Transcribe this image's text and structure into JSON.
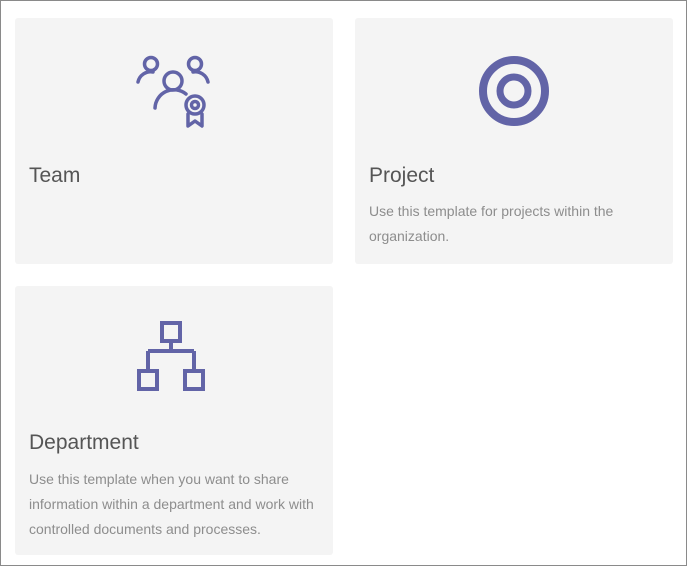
{
  "colors": {
    "accent": "#6264a7",
    "card_bg": "#f4f4f4",
    "title": "#555555",
    "description": "#8d8d8d"
  },
  "templates": [
    {
      "title": "Team",
      "description": "",
      "icon": "team-award-icon"
    },
    {
      "title": "Project",
      "description": "Use this template for projects within the organization.",
      "icon": "target-icon"
    },
    {
      "title": "Department",
      "description": "Use this template when you want to share information within a department and work with controlled documents and processes.",
      "icon": "org-chart-icon"
    }
  ]
}
